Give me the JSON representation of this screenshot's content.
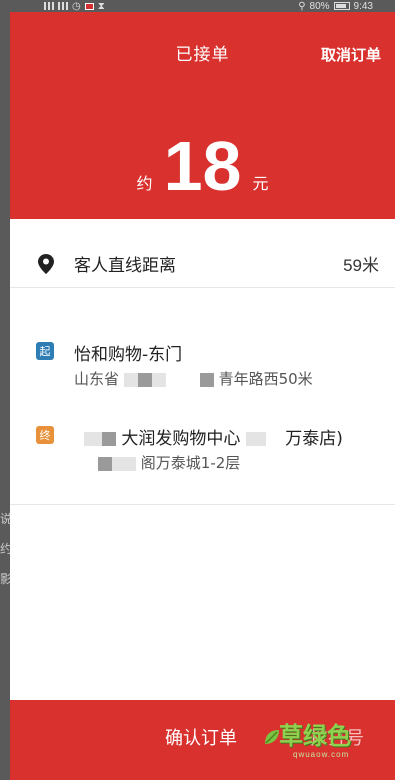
{
  "statusbar": {
    "battery": "80%",
    "time": "9:43"
  },
  "header": {
    "title": "已接单",
    "cancel_label": "取消订单",
    "price_prefix": "约",
    "price_value": "18",
    "price_suffix": "元"
  },
  "distance": {
    "label": "客人直线距离",
    "value": "59米"
  },
  "pickup": {
    "tag": "起",
    "title": "怡和购物-东门",
    "address_start": "山东省",
    "address_end": "青年路西50米"
  },
  "dropoff": {
    "tag": "终",
    "title_mid": "大润发购物中心",
    "title_end": "万泰店)",
    "address_end": "阁万泰城1-2层"
  },
  "footer": {
    "confirm_label": "确认订单",
    "tail_text": "拨打号"
  },
  "watermark": {
    "text": "草绿色",
    "sub": "qwuaow.com"
  },
  "colors": {
    "accent_red": "#d9312e",
    "start_tag": "#2e7db4",
    "end_tag": "#e8913a"
  }
}
